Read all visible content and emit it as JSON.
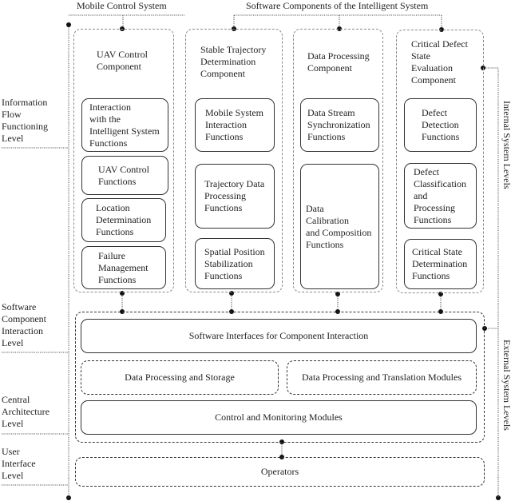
{
  "headers": {
    "mobile_control_system": "Mobile Control System",
    "software_components": "Software Components of the Intelligent System"
  },
  "levels": {
    "information_flow": "Information\nFlow\nFunctioning\nLevel",
    "software_component_interaction": "Software\nComponent\nInteraction\nLevel",
    "central_architecture": "Central\nArchitecture\nLevel",
    "user_interface": "User\nInterface\nLevel"
  },
  "side_labels": {
    "internal": "Internal System Levels",
    "external": "External System Levels"
  },
  "components": [
    {
      "title": "UAV Control\nComponent",
      "functions": [
        "Interaction\nwith the\nIntelligent System\nFunctions",
        "UAV Control\nFunctions",
        "Location\nDetermination\nFunctions",
        "Failure\nManagement\nFunctions"
      ]
    },
    {
      "title": "Stable Trajectory\nDetermination\nComponent",
      "functions": [
        "Mobile System\nInteraction\nFunctions",
        "Trajectory Data\nProcessing\nFunctions",
        "Spatial Position\nStabilization\nFunctions"
      ]
    },
    {
      "title": "Data Processing\nComponent",
      "functions": [
        "Data Stream\nSynchronization\nFunctions",
        "Data\nCalibration\nand Composition\nFunctions"
      ]
    },
    {
      "title": "Critical Defect\nState\nEvaluation\nComponent",
      "functions": [
        "Defect\nDetection\nFunctions",
        "Defect\nClassification\nand\nProcessing\nFunctions",
        "Critical State\nDetermination\nFunctions"
      ]
    }
  ],
  "external": {
    "software_interfaces": "Software Interfaces for Component Interaction",
    "data_processing_storage": "Data Processing and Storage",
    "data_processing_translation": "Data Processing and Translation Modules",
    "control_monitoring": "Control and Monitoring Modules",
    "operators": "Operators"
  }
}
